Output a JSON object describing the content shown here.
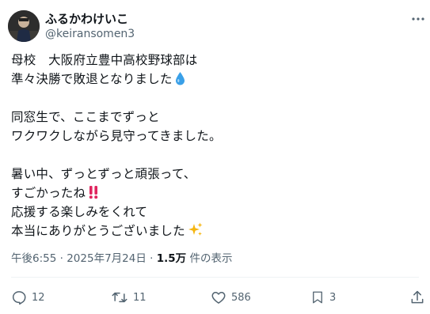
{
  "author": {
    "display_name": "ふるかわけいこ",
    "handle": "@keiransomen3"
  },
  "tweet": {
    "lines": [
      "母校　大阪府立豊中高校野球部は",
      "準々決勝で敗退となりました",
      "",
      "同窓生で、ここまでずっと",
      "ワクワクしながら見守ってきました。",
      "",
      "暑い中、ずっとずっと頑張って、",
      "すごかったね",
      "応援する楽しみをくれて",
      "本当にありがとうございました"
    ],
    "emojis": {
      "droplet": "droplet-icon",
      "double_exclamation": "double-exclamation-icon",
      "sparkles": "sparkles-icon"
    }
  },
  "meta": {
    "time": "午後6:55",
    "separator": "·",
    "date": "2025年7月24日",
    "views_count": "1.5万",
    "views_label": "件の表示"
  },
  "actions": {
    "reply_count": "12",
    "retweet_count": "11",
    "like_count": "586",
    "bookmark_count": "3"
  },
  "colors": {
    "text": "#0f1419",
    "secondary": "#536471",
    "divider": "#eff3f4",
    "droplet": "#3aa0e8",
    "exclamation": "#e0245e",
    "sparkle": "#f5b50f"
  }
}
